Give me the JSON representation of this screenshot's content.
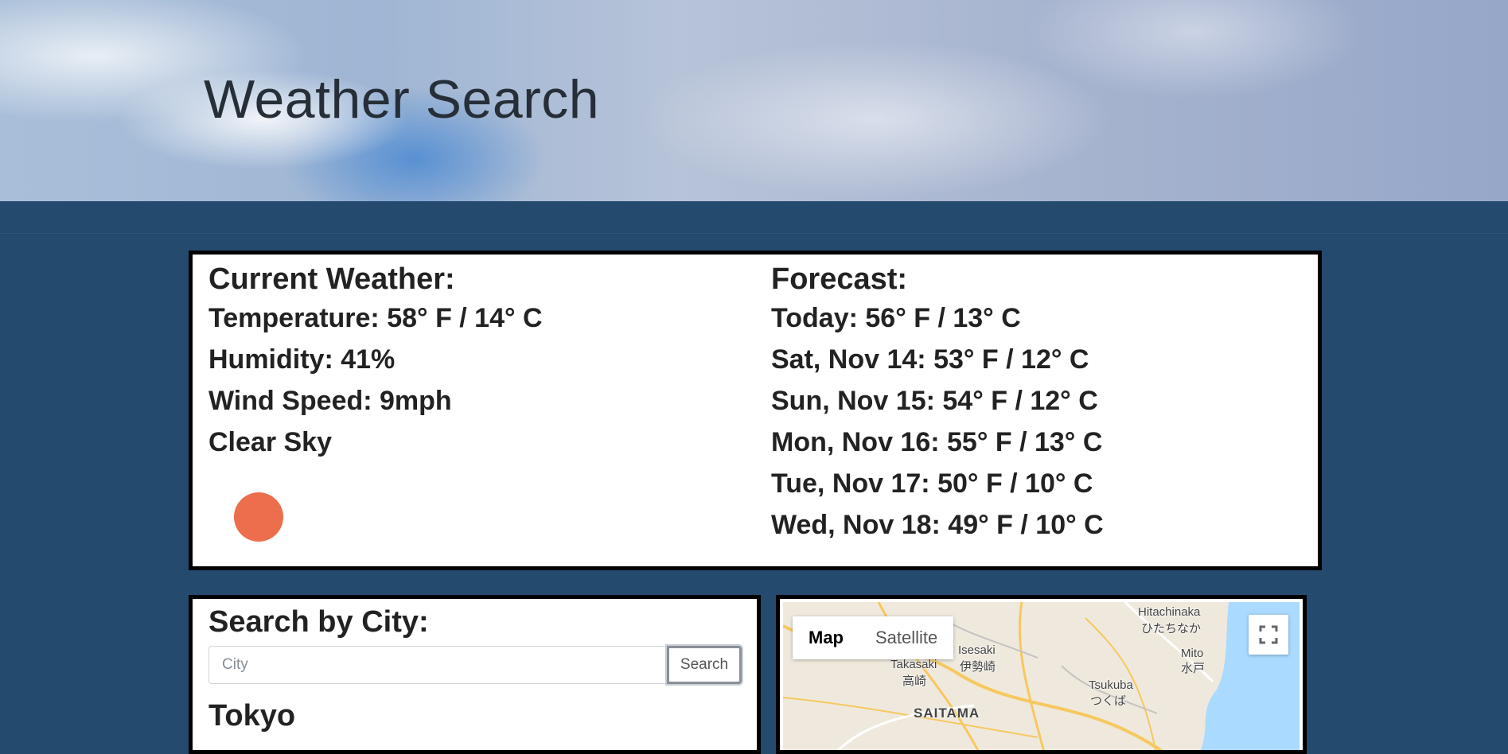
{
  "header": {
    "title": "Weather Search"
  },
  "current": {
    "heading": "Current Weather:",
    "temperature": "Temperature: 58° F / 14° C",
    "humidity": "Humidity: 41%",
    "wind": "Wind Speed: 9mph",
    "condition": "Clear Sky",
    "icon": "sun-icon",
    "icon_color": "#ed6e4c"
  },
  "forecast": {
    "heading": "Forecast:",
    "days": [
      "Today: 56° F / 13° C",
      "Sat, Nov 14: 53° F / 12° C",
      "Sun, Nov 15: 54° F / 12° C",
      "Mon, Nov 16: 55° F / 13° C",
      "Tue, Nov 17: 50° F / 10° C",
      "Wed, Nov 18: 49° F / 10° C"
    ]
  },
  "search": {
    "heading": "Search by City:",
    "placeholder": "City",
    "button_label": "Search",
    "city": "Tokyo"
  },
  "map": {
    "map_label": "Map",
    "satellite_label": "Satellite",
    "places": {
      "hitachinaka": "Hitachinaka",
      "hitachinaka_jp": "ひたちなか",
      "mito": "Mito",
      "mito_jp": "水戸",
      "isesaki": "Isesaki",
      "isesaki_jp": "伊勢崎",
      "takasaki": "Takasaki",
      "takasaki_jp": "高崎",
      "tsukuba": "Tsukuba",
      "tsukuba_jp": "つくば",
      "saitama": "SAITAMA"
    },
    "colors": {
      "land": "#efe9dd",
      "water": "#aadaff",
      "road": "#f6c85f"
    }
  }
}
